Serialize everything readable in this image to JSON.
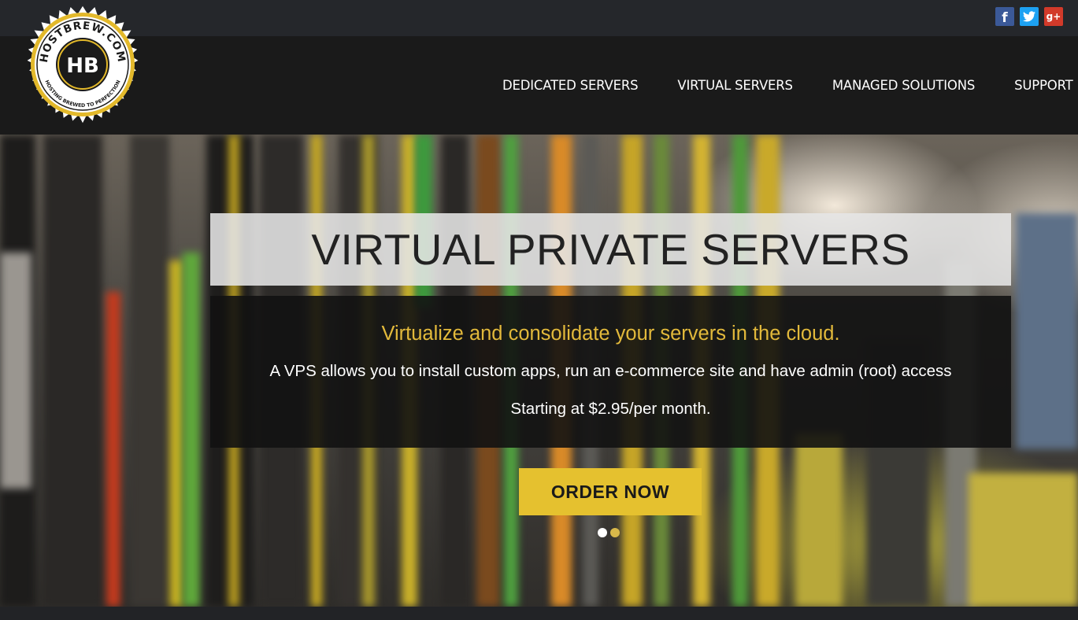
{
  "social": {
    "facebook": "f",
    "twitter": "t",
    "googleplus": "g+"
  },
  "logo": {
    "arc_top": "HOSTBREW.COM",
    "arc_bottom": "HOSTING BREWED TO PERFECTION",
    "initials": "HB"
  },
  "nav": {
    "items": [
      {
        "label": "DEDICATED SERVERS"
      },
      {
        "label": "VIRTUAL SERVERS"
      },
      {
        "label": "MANAGED SOLUTIONS"
      },
      {
        "label": "SUPPORT"
      }
    ]
  },
  "hero": {
    "title": "VIRTUAL PRIVATE SERVERS",
    "tagline": "Virtualize and consolidate your servers in the cloud.",
    "description": "A VPS allows you to install custom apps, run an e-commerce site and have admin (root) access",
    "price": "Starting at $2.95/per month.",
    "cta": "ORDER NOW",
    "slides": {
      "count": 2,
      "active": 1
    }
  },
  "colors": {
    "accent": "#e5c12f",
    "tagline": "#e2b93b",
    "nav_bg": "#1a1a1a",
    "topbar_bg": "#25272b"
  }
}
